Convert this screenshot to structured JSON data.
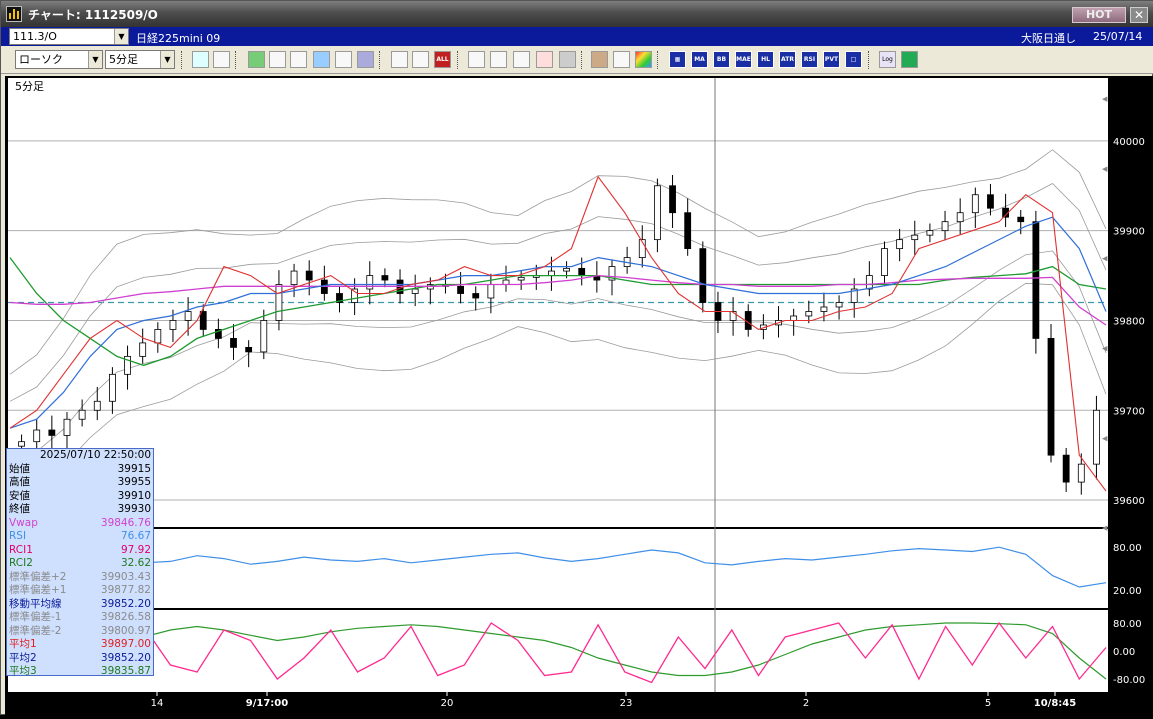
{
  "titlebar": {
    "title": "チャート: 1112509/O",
    "hot_label": "HOT",
    "close_label": "✕"
  },
  "infobar": {
    "symbol_code": "111.3/O",
    "instrument": "日経225mini 09",
    "market": "大阪日通し",
    "date": "25/07/14"
  },
  "toolbar": {
    "chart_type": "ローソク",
    "interval": "5分足",
    "indicator_labels": [
      "MA",
      "BB",
      "MAE",
      "HL",
      "ATR",
      "RSI",
      "PVT",
      "Log"
    ],
    "all_label": "ALL"
  },
  "chart": {
    "pane_label": "5分足",
    "price_ticks": [
      "40000",
      "39900",
      "39800",
      "39700",
      "39600"
    ],
    "rsi_ticks": [
      "80.00",
      "20.00"
    ],
    "rci_ticks": [
      "80.00",
      "0.00",
      "-80.00"
    ],
    "x_ticks": [
      "14",
      "9/17:00",
      "20",
      "23",
      "2",
      "5",
      "10/8:45"
    ],
    "colors": {
      "background": "#000000",
      "candle": "#ffffff",
      "ma_short": "#e03030",
      "ma_mid": "#2f6fd8",
      "ma_long": "#1e9a2e",
      "vwap": "#d040d0",
      "bands": "#9a9a9a",
      "rsi": "#3f8fe8",
      "rci1": "#ff2a90",
      "rci2": "#2e9a2e",
      "ref_line": "#3a9aa8"
    }
  },
  "chart_data": {
    "type": "candlestick",
    "x_ticks": [
      "14",
      "9/17:00",
      "20",
      "23",
      "2",
      "5",
      "10/8:45"
    ],
    "price_range": [
      39570,
      40070
    ],
    "price_ticks": [
      40000,
      39900,
      39800,
      39700,
      39600
    ],
    "reference_line": 39820,
    "ma_short": [
      39680,
      39700,
      39740,
      39780,
      39800,
      39780,
      39770,
      39800,
      39860,
      39850,
      39830,
      39840,
      39850,
      39830,
      39830,
      39840,
      39845,
      39860,
      39850,
      39850,
      39860,
      39880,
      39960,
      39920,
      39870,
      39830,
      39810,
      39810,
      39790,
      39800,
      39800,
      39810,
      39815,
      39830,
      39880,
      39890,
      39900,
      39910,
      39940,
      39920,
      39650,
      39610
    ],
    "ma_mid": [
      39680,
      39690,
      39720,
      39760,
      39790,
      39800,
      39805,
      39815,
      39820,
      39830,
      39830,
      39835,
      39840,
      39840,
      39840,
      39840,
      39845,
      39850,
      39850,
      39855,
      39860,
      39860,
      39870,
      39865,
      39860,
      39850,
      39840,
      39835,
      39830,
      39830,
      39830,
      39830,
      39835,
      39840,
      39850,
      39860,
      39875,
      39890,
      39905,
      39915,
      39880,
      39810
    ],
    "ma_long": [
      39870,
      39830,
      39800,
      39780,
      39760,
      39750,
      39760,
      39780,
      39790,
      39800,
      39810,
      39815,
      39820,
      39825,
      39830,
      39835,
      39840,
      39840,
      39845,
      39850,
      39850,
      39850,
      39850,
      39845,
      39840,
      39840,
      39840,
      39840,
      39840,
      39840,
      39840,
      39840,
      39840,
      39840,
      39840,
      39845,
      39848,
      39850,
      39852,
      39860,
      39840,
      39835
    ],
    "vwap": [
      39820,
      39818,
      39818,
      39820,
      39825,
      39830,
      39832,
      39835,
      39838,
      39838,
      39838,
      39838,
      39838,
      39838,
      39838,
      39838,
      39838,
      39840,
      39840,
      39840,
      39842,
      39845,
      39850,
      39848,
      39845,
      39842,
      39840,
      39840,
      39838,
      39838,
      39838,
      39840,
      39840,
      39842,
      39845,
      39846,
      39847,
      39847,
      39847,
      39848,
      39815,
      39795
    ],
    "candles_close": [
      39665,
      39678,
      39672,
      39690,
      39700,
      39710,
      39740,
      39760,
      39775,
      39790,
      39800,
      39810,
      39790,
      39780,
      39770,
      39765,
      39800,
      39840,
      39855,
      39845,
      39830,
      39820,
      39835,
      39850,
      39845,
      39830,
      39835,
      39840,
      39838,
      39830,
      39825,
      39840,
      39845,
      39848,
      39850,
      39855,
      39858,
      39850,
      39845,
      39860,
      39870,
      39890,
      39950,
      39920,
      39880,
      39820,
      39800,
      39810,
      39790,
      39795,
      39800,
      39805,
      39810,
      39815,
      39820,
      39835,
      39850,
      39880,
      39890,
      39895,
      39900,
      39910,
      39920,
      39940,
      39925,
      39915,
      39910,
      39780,
      39650,
      39620,
      39640,
      39700
    ],
    "rsi": [
      72,
      68,
      66,
      70,
      62,
      58,
      60,
      68,
      64,
      56,
      60,
      66,
      62,
      60,
      64,
      58,
      62,
      66,
      70,
      72,
      65,
      60,
      64,
      70,
      76,
      72,
      58,
      55,
      60,
      64,
      62,
      66,
      70,
      75,
      78,
      76,
      74,
      80,
      70,
      40,
      24,
      30
    ],
    "rci1": [
      75,
      20,
      -60,
      -70,
      10,
      70,
      -40,
      -60,
      60,
      30,
      -80,
      -20,
      60,
      -60,
      -20,
      70,
      -70,
      -40,
      80,
      30,
      -70,
      -60,
      75,
      -60,
      -90,
      40,
      -50,
      60,
      -70,
      40,
      60,
      80,
      -20,
      75,
      -80,
      70,
      -40,
      80,
      -20,
      70,
      -80,
      10
    ],
    "rci2": [
      80,
      75,
      60,
      30,
      20,
      40,
      60,
      70,
      60,
      45,
      30,
      40,
      55,
      65,
      70,
      75,
      70,
      60,
      50,
      40,
      30,
      10,
      -20,
      -40,
      -60,
      -70,
      -70,
      -60,
      -40,
      -10,
      20,
      40,
      60,
      70,
      75,
      80,
      80,
      78,
      75,
      50,
      -20,
      -80
    ]
  },
  "databox": {
    "timestamp": "2025/07/10 22:50:00",
    "rows": [
      {
        "label": "始値",
        "value": "39915",
        "color": "#000000"
      },
      {
        "label": "高値",
        "value": "39955",
        "color": "#000000"
      },
      {
        "label": "安値",
        "value": "39910",
        "color": "#000000"
      },
      {
        "label": "終値",
        "value": "39930",
        "color": "#000000"
      },
      {
        "label": "Vwap",
        "value": "39846.76",
        "color": "#d040d0"
      },
      {
        "label": "RSI",
        "value": "76.67",
        "color": "#3f8fe8"
      },
      {
        "label": "RCI1",
        "value": "97.92",
        "color": "#e0006a"
      },
      {
        "label": "RCI2",
        "value": "32.62",
        "color": "#1e7a1e"
      },
      {
        "label": "標準偏差+2",
        "value": "39903.43",
        "color": "#8a8a8a"
      },
      {
        "label": "標準偏差+1",
        "value": "39877.82",
        "color": "#8a8a8a"
      },
      {
        "label": "移動平均線",
        "value": "39852.20",
        "color": "#0a1a9a"
      },
      {
        "label": "標準偏差-1",
        "value": "39826.58",
        "color": "#8a8a8a"
      },
      {
        "label": "標準偏差-2",
        "value": "39800.97",
        "color": "#8a8a8a"
      },
      {
        "label": "平均1",
        "value": "39897.00",
        "color": "#e02020"
      },
      {
        "label": "平均2",
        "value": "39852.20",
        "color": "#0a1a9a"
      },
      {
        "label": "平均3",
        "value": "39835.87",
        "color": "#1e7a1e"
      }
    ]
  }
}
